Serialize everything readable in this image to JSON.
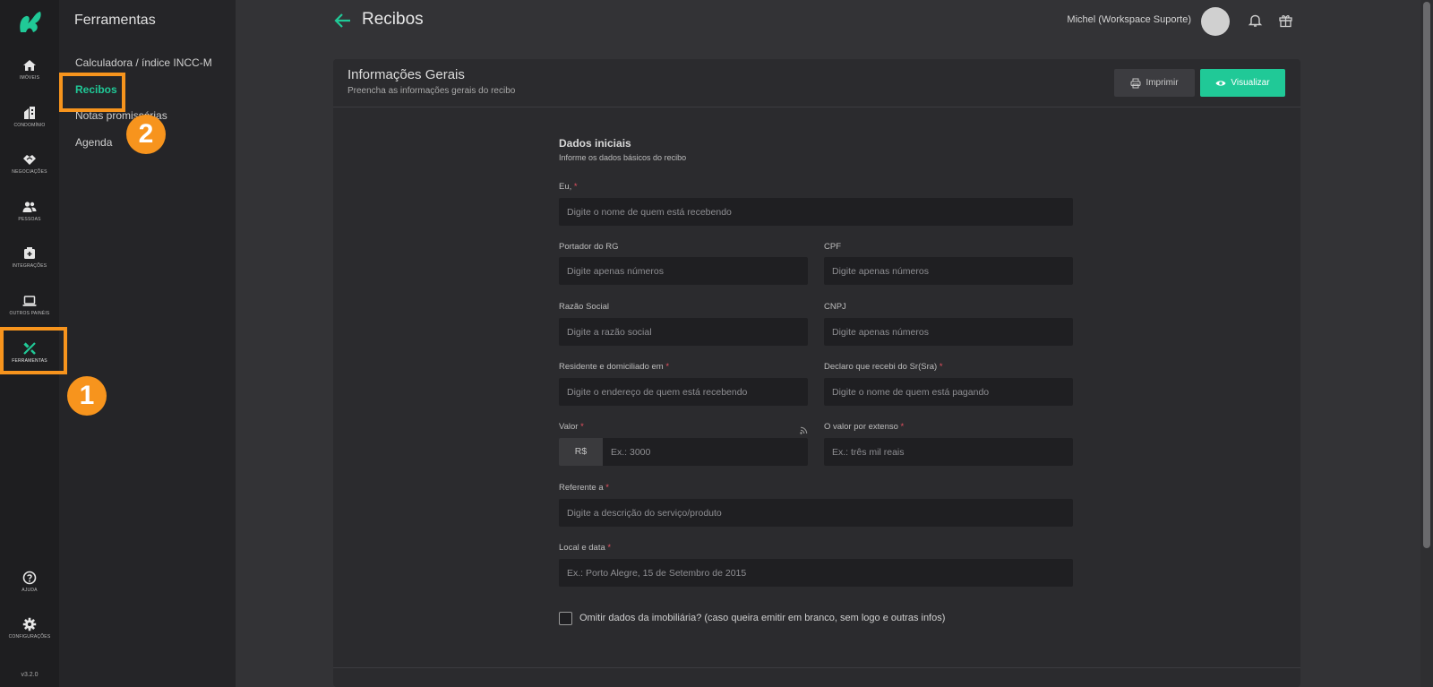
{
  "rail": {
    "items": [
      {
        "label": "Imóveis",
        "icon": "home-icon"
      },
      {
        "label": "Condomínio",
        "icon": "building-icon"
      },
      {
        "label": "Negociações",
        "icon": "handshake-icon"
      },
      {
        "label": "Pessoas",
        "icon": "people-icon"
      },
      {
        "label": "Integrações",
        "icon": "plus-box-icon"
      },
      {
        "label": "Outros Painéis",
        "icon": "laptop-icon"
      },
      {
        "label": "Ferramentas",
        "icon": "tools-icon"
      }
    ],
    "help_label": "Ajuda",
    "settings_label": "Configurações",
    "version": "v3.2.0"
  },
  "subnav": {
    "title": "Ferramentas",
    "items": [
      {
        "label": "Calculadora / índice INCC-M"
      },
      {
        "label": "Recibos"
      },
      {
        "label": "Notas promissórias"
      },
      {
        "label": "Agenda"
      }
    ]
  },
  "annotations": {
    "badge1": "1",
    "badge2": "2"
  },
  "header": {
    "title": "Recibos",
    "user_name": "Michel (Workspace Suporte)"
  },
  "card": {
    "title": "Informações Gerais",
    "subtitle": "Preencha as informações gerais do recibo",
    "print_label": "Imprimir",
    "view_label": "Visualizar"
  },
  "form": {
    "section_title": "Dados iniciais",
    "section_subtitle": "Informe os dados básicos do recibo",
    "required_mark": "*",
    "fields": {
      "eu": {
        "label": "Eu,",
        "placeholder": "Digite o nome de quem está recebendo"
      },
      "rg": {
        "label": "Portador do RG",
        "placeholder": "Digite apenas números"
      },
      "cpf": {
        "label": "CPF",
        "placeholder": "Digite apenas números"
      },
      "razao": {
        "label": "Razão Social",
        "placeholder": "Digite a razão social"
      },
      "cnpj": {
        "label": "CNPJ",
        "placeholder": "Digite apenas números"
      },
      "residente": {
        "label": "Residente e domiciliado em",
        "placeholder": "Digite o endereço de quem está recebendo"
      },
      "declaro": {
        "label": "Declaro que recebi do Sr(Sra)",
        "placeholder": "Digite o nome de quem está pagando"
      },
      "valor": {
        "label": "Valor",
        "prefix": "R$",
        "placeholder": "Ex.: 3000"
      },
      "extenso": {
        "label": "O valor por extenso",
        "placeholder": "Ex.: três mil reais"
      },
      "referente": {
        "label": "Referente a",
        "placeholder": "Digite a descrição do serviço/produto"
      },
      "local": {
        "label": "Local e data",
        "placeholder": "Ex.: Porto Alegre, 15 de Setembro de 2015"
      }
    },
    "omit_label": "Omitir dados da imobiliária? (caso queira emitir em branco, sem logo e outras infos)"
  },
  "colors": {
    "accent": "#20c997",
    "highlight": "#f7941d",
    "required": "#e4505f"
  }
}
